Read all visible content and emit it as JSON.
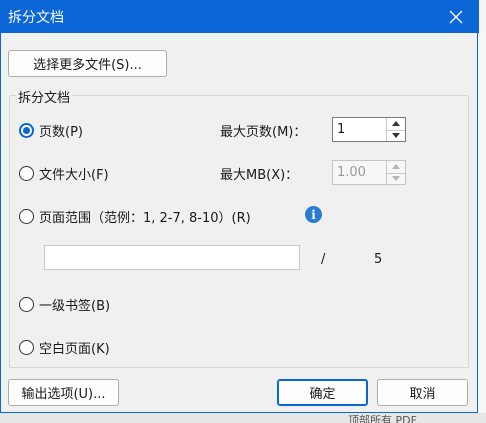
{
  "window": {
    "title": "拆分文档",
    "close_icon": "close-icon"
  },
  "select_files_button": "选择更多文件(S)...",
  "group": {
    "label": "拆分文档",
    "options": {
      "pages": "页数(P)",
      "filesize": "文件大小(F)",
      "page_range": "页面范围（范例：1, 2-7, 8-10）(R)",
      "bookmarks": "一级书签(B)",
      "blank_pages": "空白页面(K)"
    },
    "selected_option": "pages",
    "max_pages_label": "最大页数(M)：",
    "max_pages_value": "1",
    "max_mb_label": "最大MB(X)：",
    "max_mb_value": "1.00",
    "range_input_value": "",
    "range_separator": "/",
    "total_pages": "5",
    "info_icon": "info-icon"
  },
  "footer": {
    "output_options": "输出选项(U)...",
    "ok": "确定",
    "cancel": "取消"
  },
  "background_text": "顶部所有 PDF"
}
